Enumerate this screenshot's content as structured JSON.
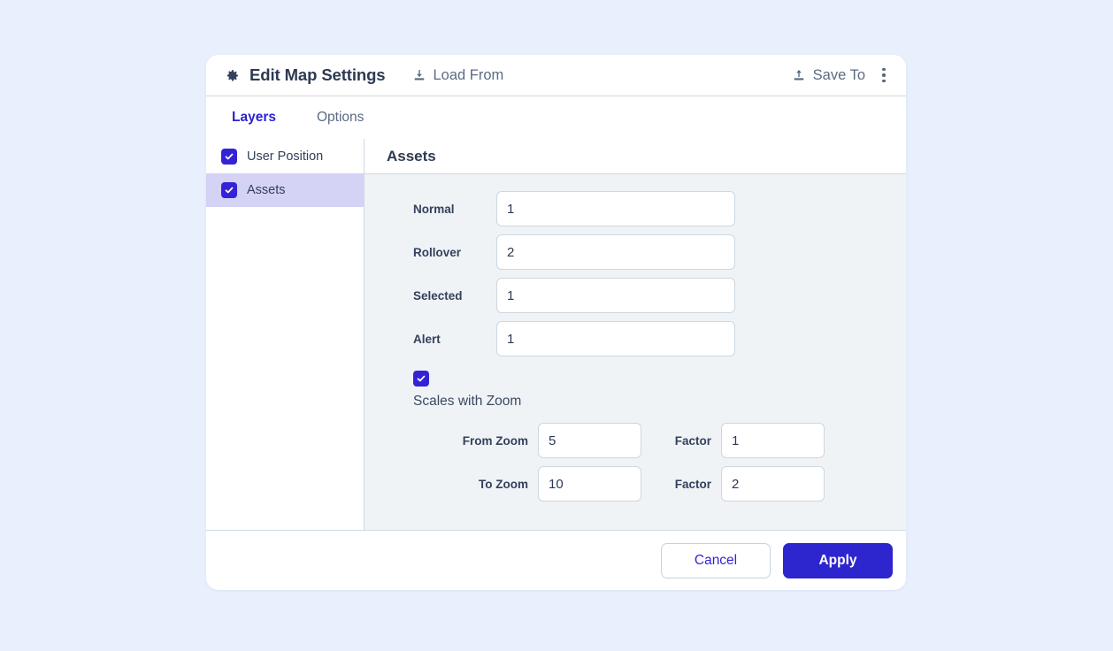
{
  "dialog": {
    "title": "Edit Map Settings",
    "gear_icon": "gear-icon",
    "load_from": {
      "label": "Load From",
      "icon": "download-icon"
    },
    "save_to": {
      "label": "Save To",
      "icon": "upload-icon"
    },
    "overflow_menu": "kebab-menu-icon"
  },
  "tabs": [
    {
      "label": "Layers",
      "active": true
    },
    {
      "label": "Options",
      "active": false
    }
  ],
  "sidebar": {
    "layers": [
      {
        "label": "User Position",
        "checked": true,
        "selected": false
      },
      {
        "label": "Assets",
        "checked": true,
        "selected": true
      }
    ]
  },
  "content": {
    "title": "Assets",
    "fields": [
      {
        "label": "Normal",
        "value": "1"
      },
      {
        "label": "Rollover",
        "value": "2"
      },
      {
        "label": "Selected",
        "value": "1"
      },
      {
        "label": "Alert",
        "value": "1"
      }
    ],
    "scales_with_zoom": {
      "label": "Scales with Zoom",
      "checked": true,
      "rows": [
        {
          "label": "From Zoom",
          "value": "5",
          "factor_label": "Factor",
          "factor_value": "1"
        },
        {
          "label": "To Zoom",
          "value": "10",
          "factor_label": "Factor",
          "factor_value": "2"
        }
      ]
    }
  },
  "footer": {
    "cancel_label": "Cancel",
    "apply_label": "Apply"
  },
  "colors": {
    "page_background": "#e8effd",
    "accent": "#2d25ce",
    "tab_active": "#2e21d6",
    "selected_row": "#d4d2f5",
    "panel_background": "#f0f3f6",
    "checkbox": "#3423d6"
  }
}
